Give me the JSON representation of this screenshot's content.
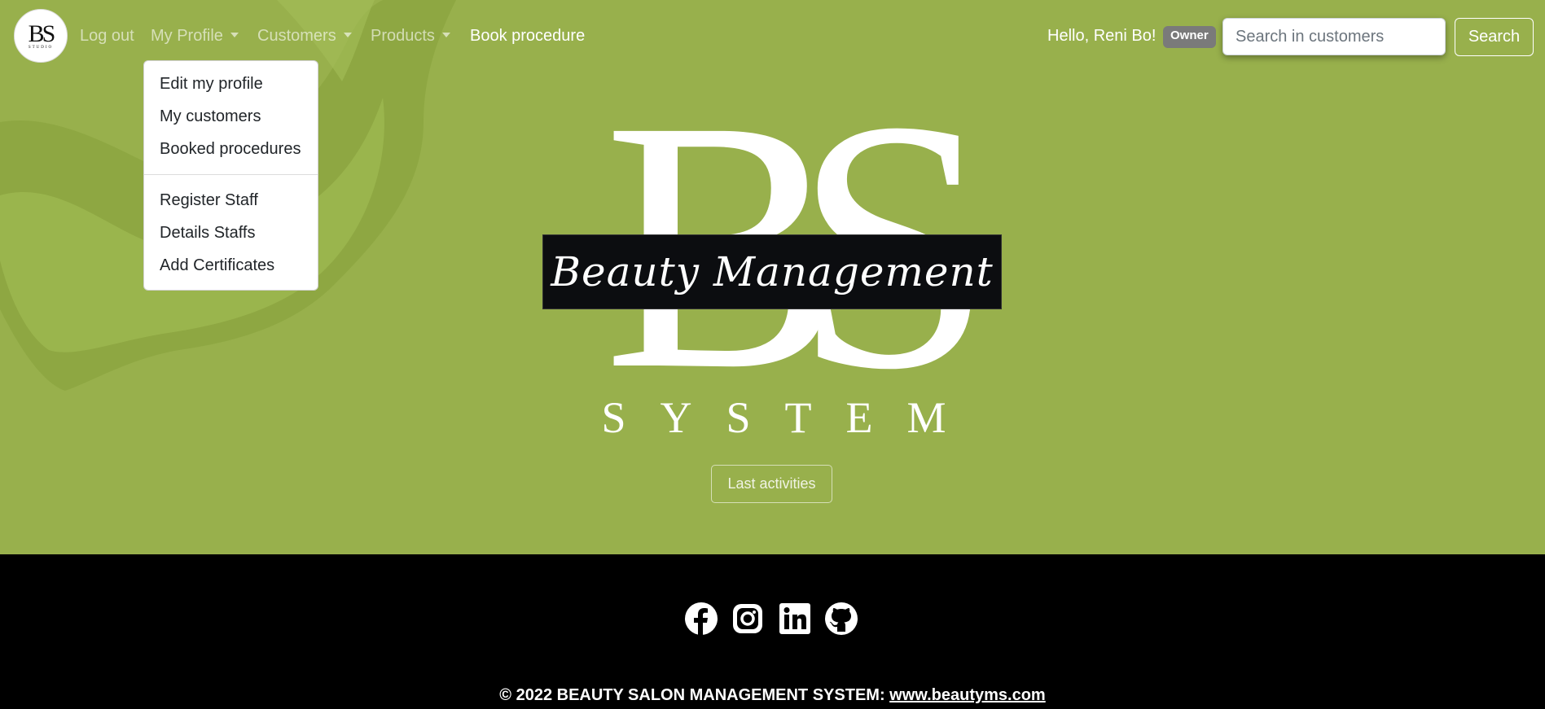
{
  "brand": {
    "logo_text": "BS",
    "logo_subtext": "STUDIO"
  },
  "nav": {
    "logout": "Log out",
    "my_profile": "My Profile",
    "customers": "Customers",
    "products": "Products",
    "book_procedure": "Book procedure"
  },
  "user": {
    "greeting": "Hello, Reni Bo!",
    "role_badge": "Owner"
  },
  "search": {
    "placeholder": "Search in customers",
    "button": "Search"
  },
  "profile_menu": {
    "items": [
      "Edit my profile",
      "My customers",
      "Booked procedures",
      "Register Staff",
      "Details Staffs",
      "Add Certificates"
    ]
  },
  "hero": {
    "logo_letters": "BS",
    "logo_script": "Beauty Management",
    "logo_system": "SYSTEM",
    "last_activities": "Last activities"
  },
  "footer": {
    "socials": [
      "facebook-icon",
      "instagram-icon",
      "linkedin-icon",
      "github-icon"
    ],
    "copyright_prefix": "© 2022 BEAUTY SALON MANAGEMENT SYSTEM: ",
    "copyright_link": "www.beautyms.com"
  },
  "colors": {
    "hero_bg": "#98b04c",
    "footer_bg": "#000000",
    "badge_bg": "#7a7a7a"
  }
}
